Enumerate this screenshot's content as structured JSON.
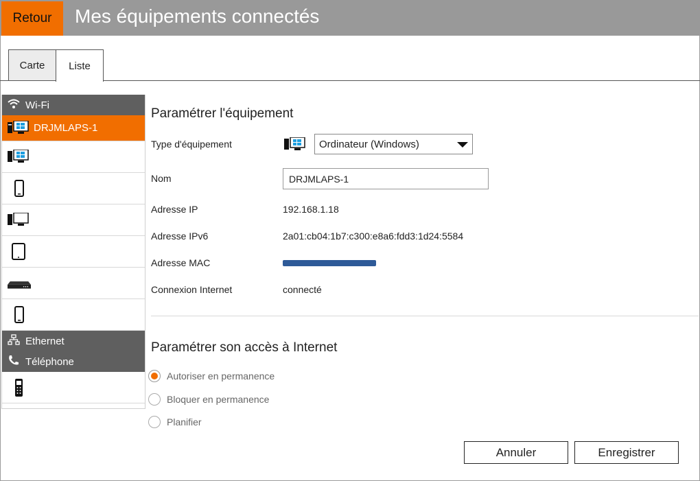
{
  "header": {
    "back_label": "Retour",
    "title": "Mes équipements connectés",
    "accent_color": "#f16e00"
  },
  "tabs": [
    {
      "label": "Carte",
      "active": false
    },
    {
      "label": "Liste",
      "active": true
    }
  ],
  "sidebar": {
    "groups": {
      "wifi": {
        "label": "Wi-Fi",
        "icon": "wifi-icon"
      },
      "ethernet": {
        "label": "Ethernet",
        "icon": "network-icon"
      },
      "phone": {
        "label": "Téléphone",
        "icon": "phone-icon"
      }
    },
    "devices": [
      {
        "name": "DRJMLAPS-1",
        "icon": "windows-computer-icon",
        "active": true,
        "redacted": false
      },
      {
        "name": "",
        "icon": "windows-computer-icon",
        "active": false,
        "redacted": true
      },
      {
        "name": "…",
        "icon": "smartphone-icon",
        "active": false,
        "redacted": true
      },
      {
        "name": "",
        "icon": "desktop-computer-icon",
        "active": false,
        "redacted": true
      },
      {
        "name": "",
        "icon": "tablet-icon",
        "active": false,
        "redacted": true
      },
      {
        "name": "",
        "icon": "network-device-icon",
        "active": false,
        "redacted": true
      },
      {
        "name": "",
        "icon": "smartphone-icon",
        "active": false,
        "redacted": true
      }
    ],
    "phone_devices": [
      {
        "name": "",
        "icon": "cordless-phone-icon",
        "redacted": true
      }
    ]
  },
  "device_settings": {
    "title": "Paramétrer l'équipement",
    "type_label": "Type d'équipement",
    "type_value": "Ordinateur (Windows)",
    "name_label": "Nom",
    "name_value": "DRJMLAPS-1",
    "ip_label": "Adresse IP",
    "ip_value": "192.168.1.18",
    "ipv6_label": "Adresse IPv6",
    "ipv6_value": "2a01:cb04:1b7:c300:e8a6:fdd3:1d24:5584",
    "mac_label": "Adresse MAC",
    "mac_value": "",
    "connection_label": "Connexion Internet",
    "connection_value": "connecté"
  },
  "access_settings": {
    "title": "Paramétrer son accès à Internet",
    "options": [
      {
        "label": "Autoriser en permanence",
        "checked": true
      },
      {
        "label": "Bloquer en permanence",
        "checked": false
      },
      {
        "label": "Planifier",
        "checked": false
      }
    ]
  },
  "actions": {
    "cancel_label": "Annuler",
    "save_label": "Enregistrer"
  }
}
